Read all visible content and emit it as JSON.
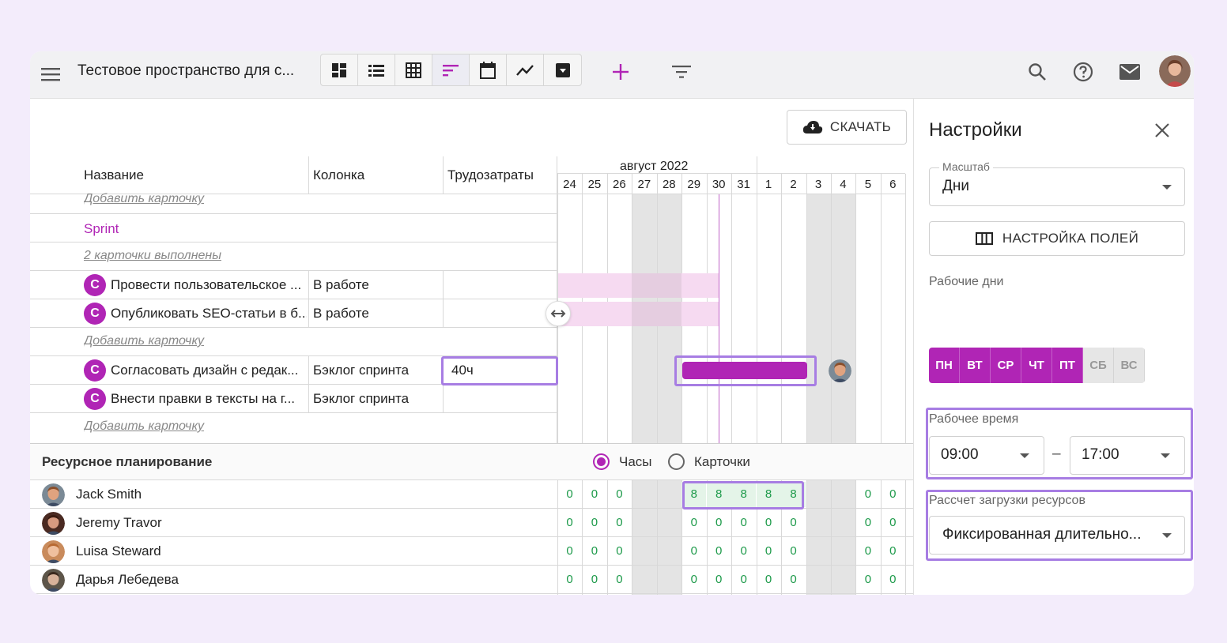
{
  "header": {
    "workspace_title": "Тестовое пространство для с...",
    "view_buttons": [
      "dashboard-icon",
      "list-icon",
      "table-icon",
      "gantt-icon",
      "calendar-icon",
      "chart-icon",
      "archive-icon"
    ]
  },
  "toolbar": {
    "download_label": "СКАЧАТЬ"
  },
  "columns": {
    "name": "Название",
    "column": "Колонка",
    "effort": "Трудозатраты"
  },
  "timeline": {
    "month": "август 2022",
    "days": [
      "24",
      "25",
      "26",
      "27",
      "28",
      "29",
      "30",
      "31",
      "1",
      "2",
      "3",
      "4",
      "5",
      "6"
    ]
  },
  "rows": {
    "add_card_top": "Добавить карточку",
    "sprint": "Sprint",
    "done_cards": "2 карточки выполнены",
    "tasks1": [
      {
        "badge": "C",
        "title": "Провести пользовательское ...",
        "column": "В работе",
        "effort": ""
      },
      {
        "badge": "C",
        "title": "Опубликовать SEO-статьи в б...",
        "column": "В работе",
        "effort": ""
      }
    ],
    "add_card_mid": "Добавить карточку",
    "tasks2": [
      {
        "badge": "C",
        "title": "Согласовать дизайн с редак...",
        "column": "Бэклог спринта",
        "effort": "40ч"
      },
      {
        "badge": "C",
        "title": "Внести правки в тексты на г...",
        "column": "Бэклог спринта",
        "effort": ""
      }
    ],
    "add_card_bottom": "Добавить карточку"
  },
  "resources": {
    "title": "Ресурсное планирование",
    "mode_hours": "Часы",
    "mode_cards": "Карточки",
    "people": [
      {
        "name": "Jack Smith",
        "loads": [
          "0",
          "0",
          "0",
          "",
          "",
          "8",
          "8",
          "8",
          "8",
          "8",
          "",
          "",
          "0",
          "0"
        ]
      },
      {
        "name": "Jeremy Travor",
        "loads": [
          "0",
          "0",
          "0",
          "",
          "",
          "0",
          "0",
          "0",
          "0",
          "0",
          "",
          "",
          "0",
          "0"
        ]
      },
      {
        "name": "Luisa Steward",
        "loads": [
          "0",
          "0",
          "0",
          "",
          "",
          "0",
          "0",
          "0",
          "0",
          "0",
          "",
          "",
          "0",
          "0"
        ]
      },
      {
        "name": "Дарья Лебедева",
        "loads": [
          "0",
          "0",
          "0",
          "",
          "",
          "0",
          "0",
          "0",
          "0",
          "0",
          "",
          "",
          "0",
          "0"
        ]
      }
    ]
  },
  "settings": {
    "title": "Настройки",
    "scale_label": "Масштаб",
    "scale_value": "Дни",
    "fields_button": "НАСТРОЙКА ПОЛЕЙ",
    "workdays_label": "Рабочие дни",
    "days": [
      {
        "label": "ПН",
        "on": true
      },
      {
        "label": "ВТ",
        "on": true
      },
      {
        "label": "СР",
        "on": true
      },
      {
        "label": "ЧТ",
        "on": true
      },
      {
        "label": "ПТ",
        "on": true
      },
      {
        "label": "СБ",
        "on": false
      },
      {
        "label": "ВС",
        "on": false
      }
    ],
    "worktime_label": "Рабочее время",
    "time_from": "09:00",
    "time_dash": "–",
    "time_to": "17:00",
    "calc_label": "Рассчет загрузки ресурсов",
    "calc_value": "Фиксированная длительно..."
  },
  "colors": {
    "accent": "#b025b5",
    "highlight": "#a77de3",
    "grey_day": "#e4e4e4",
    "task_bar_light": "#f6daf1",
    "zero_green": "#1d9a4a"
  }
}
